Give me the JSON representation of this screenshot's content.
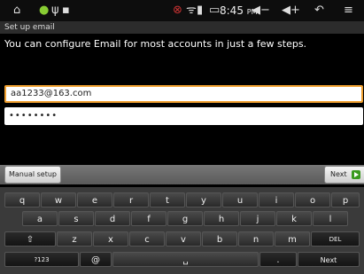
{
  "status": {
    "time": "8:45",
    "ampm": "PM",
    "icons": [
      "home-icon",
      "android-icon",
      "usb-icon",
      "sd-card-icon",
      "alert-icon",
      "wifi-icon",
      "signal-icon",
      "battery-icon",
      "volume-down-icon",
      "volume-up-icon",
      "back-icon",
      "menu-icon"
    ]
  },
  "title": "Set up email",
  "instructions": "You can configure Email for most accounts in just a few steps.",
  "form": {
    "email_value": "aa1233@163.com",
    "password_value": "••••••••"
  },
  "buttons": {
    "manual": "Manual setup",
    "next": "Next"
  },
  "keyboard": {
    "row1": [
      "q",
      "w",
      "e",
      "r",
      "t",
      "y",
      "u",
      "i",
      "o",
      "p"
    ],
    "row2": [
      "a",
      "s",
      "d",
      "f",
      "g",
      "h",
      "j",
      "k",
      "l"
    ],
    "row3": [
      "z",
      "x",
      "c",
      "v",
      "b",
      "n",
      "m"
    ],
    "shift": "⇧",
    "delete": "DEL",
    "numbers": "?123",
    "at": "@",
    "space": "␣",
    "period": ".",
    "enter": "Next"
  }
}
